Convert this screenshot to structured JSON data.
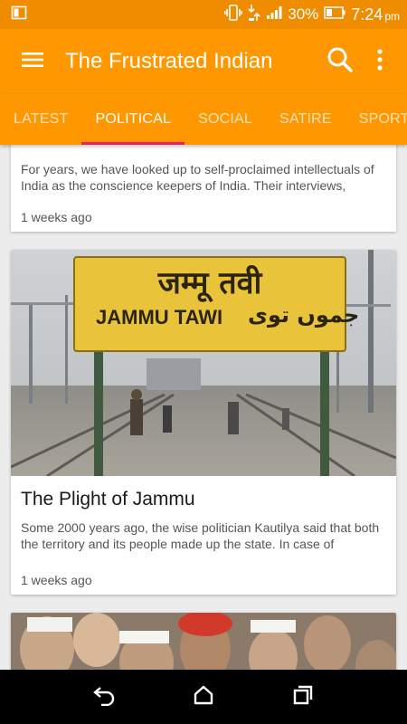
{
  "status_bar": {
    "battery_percent": "30%",
    "time": "7:24",
    "ampm": "pm",
    "icons": [
      "screen-mirror-icon",
      "vibrate-icon",
      "data-transfer-icon",
      "signal-icon",
      "battery-icon"
    ]
  },
  "app_bar": {
    "title": "The Frustrated Indian",
    "icons": [
      "menu-icon",
      "search-icon",
      "more-vert-icon"
    ]
  },
  "tabs": [
    {
      "label": "LATEST",
      "active": false
    },
    {
      "label": "POLITICAL",
      "active": true
    },
    {
      "label": "SOCIAL",
      "active": false
    },
    {
      "label": "SATIRE",
      "active": false
    },
    {
      "label": "SPORTS",
      "active": false
    }
  ],
  "articles": [
    {
      "title": "",
      "excerpt": "For years, we have looked up to self-proclaimed intellectuals of India as the conscience keepers of India. Their interviews,",
      "time": "1 weeks ago"
    },
    {
      "title": "The Plight of Jammu",
      "excerpt": "Some 2000 years ago, the wise politician Kautilya said that both the territory and its people made up the state. In case of",
      "time": "1 weeks ago",
      "image_sign_hindi": "जम्मू तवी",
      "image_sign_english": "JAMMU TAWI",
      "image_sign_urdu": "جموں توی"
    }
  ],
  "colors": {
    "status_bar": "#f08c00",
    "primary": "#ff9800",
    "tab_indicator": "#e91e63",
    "background": "#ececec"
  },
  "nav_bar": {
    "icons": [
      "back-icon",
      "home-icon",
      "recents-icon"
    ]
  }
}
